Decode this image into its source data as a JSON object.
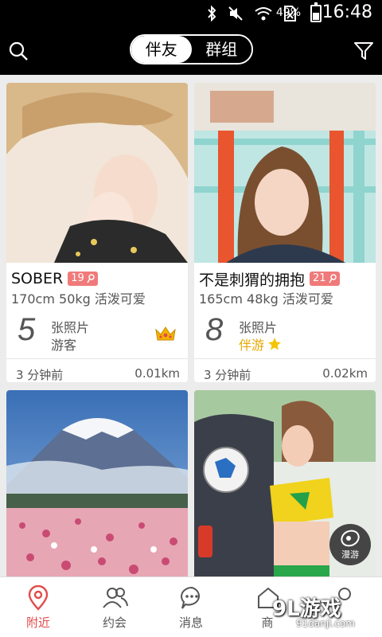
{
  "status_bar": {
    "battery": "49%",
    "battery_level": 0.49,
    "time": "16:48",
    "icons": [
      "bluetooth-icon",
      "mute-icon",
      "wifi-icon",
      "no-sim-icon",
      "battery-icon"
    ]
  },
  "header": {
    "segments": [
      "伴友",
      "群组"
    ],
    "active_segment": 0,
    "left_icon": "search-icon",
    "right_icon": "filter-icon"
  },
  "cards": [
    {
      "name": "SOBER",
      "age": "19",
      "gender_icon": "female-icon",
      "stats": "170cm 50kg 活泼可爱",
      "photo_count": "5",
      "photo_label": "张照片",
      "role": "游客",
      "badge_icon": "crown-icon",
      "time": "3 分钟前",
      "distance": "0.01km"
    },
    {
      "name": "不是刺猬的拥抱",
      "age": "21",
      "gender_icon": "female-icon",
      "stats": "165cm 48kg 活泼可爱",
      "photo_count": "8",
      "photo_label": "张照片",
      "role": "伴游",
      "badge_icon": "star-icon",
      "time": "3 分钟前",
      "distance": "0.02km"
    },
    {
      "name": "",
      "photo": "mountain-flowers"
    },
    {
      "name": "",
      "photo": "soccer-girl"
    }
  ],
  "map_fab": {
    "label": "漫游",
    "icon": "globe-icon"
  },
  "bottom_nav": [
    {
      "label": "附近",
      "icon": "location-pin-icon",
      "active": true
    },
    {
      "label": "约会",
      "icon": "people-icon",
      "active": false
    },
    {
      "label": "消息",
      "icon": "chat-bubble-icon",
      "active": false
    },
    {
      "label": "商",
      "icon": "home-icon",
      "active": false
    },
    {
      "label": "",
      "icon": "profile-icon",
      "active": false
    }
  ],
  "watermark": {
    "text": "9L游戏",
    "url": "91danji.com"
  },
  "colors": {
    "accent": "#e34b4b",
    "age_badge": "#f07a7a",
    "guide_gold": "#e6a800"
  }
}
